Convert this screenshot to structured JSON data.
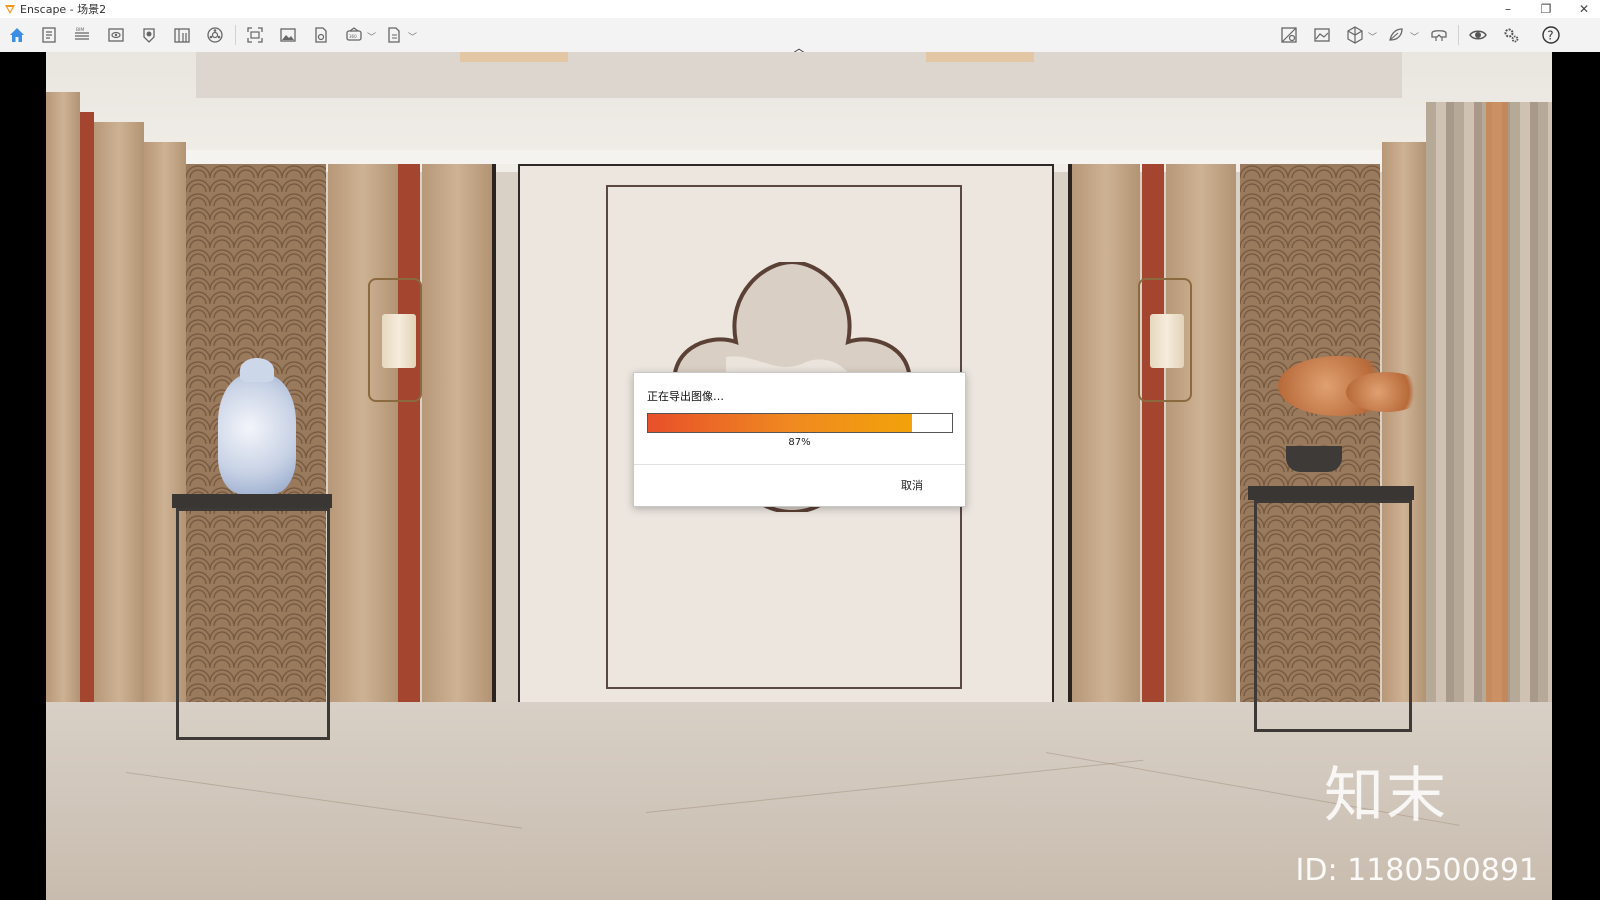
{
  "window": {
    "title": "Enscape - 场景2",
    "controls": [
      "–",
      "❐",
      "✕"
    ]
  },
  "toolbar": {
    "left_icons": [
      "home-icon",
      "notes-icon",
      "bim-icon",
      "view-icon",
      "layers-icon",
      "book-icon",
      "settings-wheel-icon",
      "screenshot-icon",
      "image-icon",
      "export-file-icon",
      "panorama-icon",
      "batch-export-icon"
    ],
    "right_icons": [
      "material-icon",
      "atlas-icon",
      "cube-icon",
      "asset-library-icon",
      "vr-headset-icon",
      "visibility-icon",
      "settings-icon",
      "help-icon"
    ],
    "accent": "#3a8ee6"
  },
  "dialog": {
    "title": "正在导出图像…",
    "progress": 0.87,
    "progress_label": "87%",
    "cancel_label": "取消"
  },
  "watermark": {
    "logo": "知末",
    "id": "ID: 1180500891"
  }
}
